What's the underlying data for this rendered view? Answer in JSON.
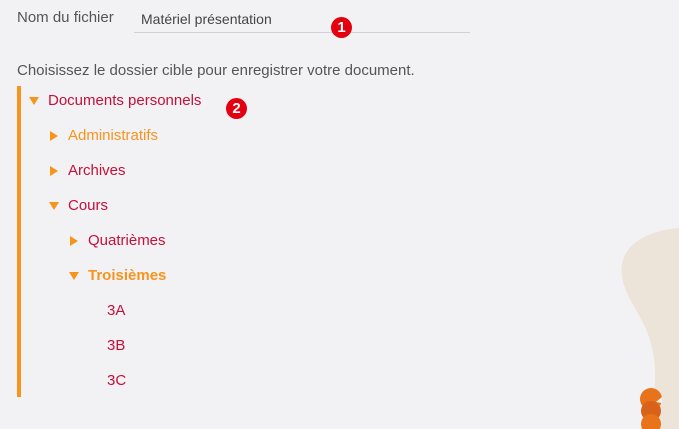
{
  "filename": {
    "label": "Nom du fichier",
    "value": "Matériel présentation"
  },
  "badges": {
    "first": "1",
    "second": "2"
  },
  "instruction": "Choisissez le dossier cible pour enregistrer votre document.",
  "tree": {
    "root": "Documents personnels",
    "administratifs": "Administratifs",
    "archives": "Archives",
    "cours": "Cours",
    "quatriemes": "Quatrièmes",
    "troisiemes": "Troisièmes",
    "class_3a": "3A",
    "class_3b": "3B",
    "class_3c": "3C"
  },
  "colors": {
    "accent_orange": "#f7941d",
    "link_red": "#c4103a",
    "badge_red": "#e3000f"
  }
}
